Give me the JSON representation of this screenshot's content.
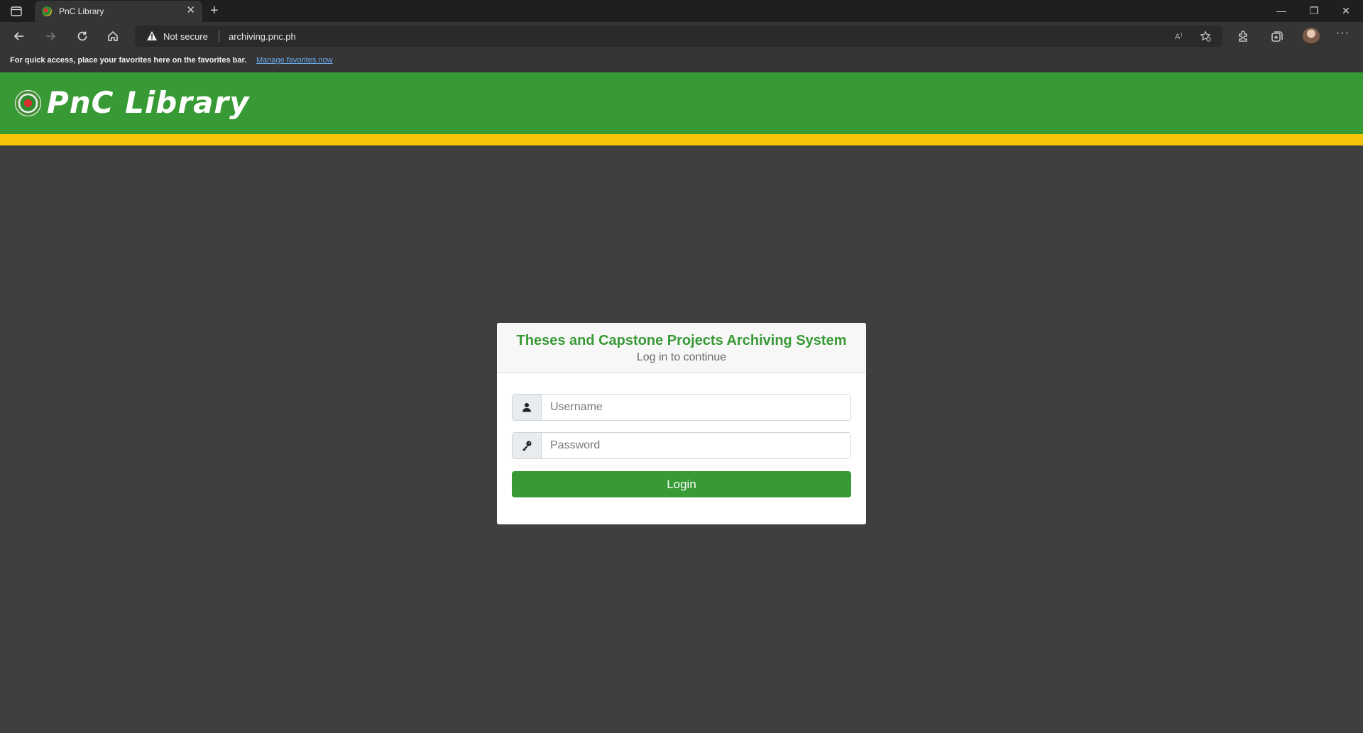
{
  "browser": {
    "tab_title": "PnC Library",
    "tab_close": "✕",
    "new_tab": "+",
    "security_label": "Not secure",
    "url": "archiving.pnc.ph",
    "window_controls": {
      "minimize": "—",
      "restore": "❐",
      "close": "✕"
    },
    "more": "···",
    "favorites_bar": {
      "text": "For quick access, place your favorites here on the favorites bar.",
      "link": "Manage favorites now"
    }
  },
  "site": {
    "brand": "PnC Library",
    "colors": {
      "primary": "#379a35",
      "accent": "#f7c40c",
      "background": "#3f3f3f"
    }
  },
  "login": {
    "title": "Theses and Capstone Projects Archiving System",
    "subtitle": "Log in to continue",
    "username": {
      "placeholder": "Username",
      "value": "",
      "icon": "user-icon"
    },
    "password": {
      "placeholder": "Password",
      "value": "",
      "icon": "key-icon"
    },
    "button": "Login"
  }
}
